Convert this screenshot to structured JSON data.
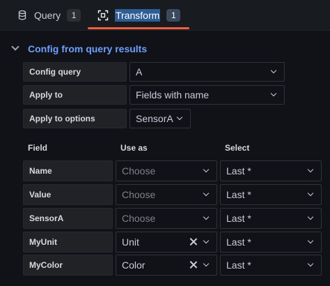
{
  "tabs": [
    {
      "label": "Query",
      "count": "1",
      "icon": "database-icon"
    },
    {
      "label": "Transform",
      "count": "1",
      "icon": "transform-icon"
    }
  ],
  "section": {
    "title": "Config from query results"
  },
  "config": {
    "config_query_label": "Config query",
    "config_query_value": "A",
    "apply_to_label": "Apply to",
    "apply_to_value": "Fields with name",
    "apply_to_options_label": "Apply to options",
    "apply_to_options_value": "SensorA"
  },
  "mapping": {
    "headers": {
      "field": "Field",
      "use_as": "Use as",
      "select": "Select"
    },
    "rows": [
      {
        "field": "Name",
        "use_as": "Choose",
        "select": "Last *"
      },
      {
        "field": "Value",
        "use_as": "Choose",
        "select": "Last *"
      },
      {
        "field": "SensorA",
        "use_as": "Choose",
        "select": "Last *"
      },
      {
        "field": "MyUnit",
        "use_as": "Unit",
        "select": "Last *"
      },
      {
        "field": "MyColor",
        "use_as": "Color",
        "select": "Last *"
      }
    ]
  },
  "colors": {
    "accent": "#6e9fff",
    "tab_underline": "#f55f3e",
    "background": "#111217"
  }
}
